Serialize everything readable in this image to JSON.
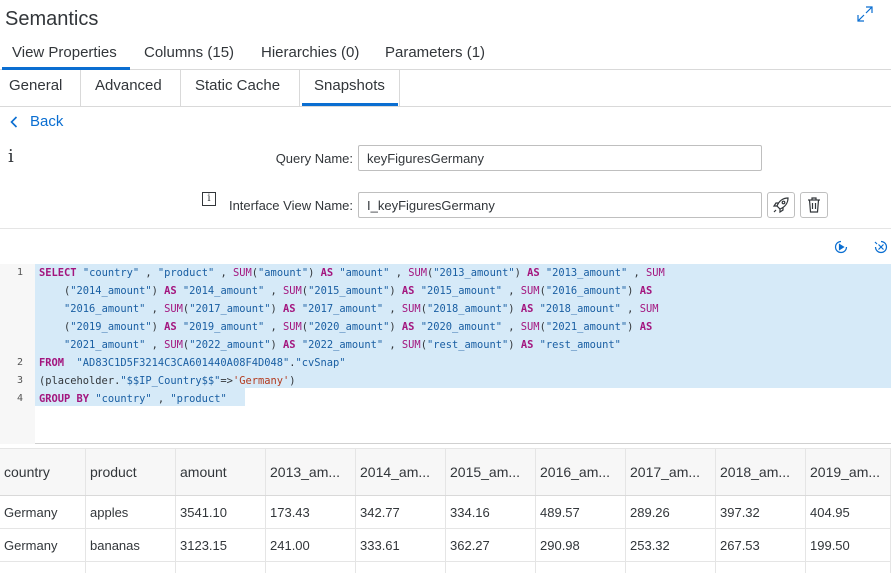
{
  "window": {
    "title": "Semantics",
    "expand_icon": "expand-icon"
  },
  "tabs_primary": [
    {
      "label": "View Properties",
      "active": true
    },
    {
      "label": "Columns (15)",
      "active": false
    },
    {
      "label": "Hierarchies (0)",
      "active": false
    },
    {
      "label": "Parameters (1)",
      "active": false
    }
  ],
  "tabs_secondary": [
    {
      "label": "General",
      "active": false
    },
    {
      "label": "Advanced",
      "active": false
    },
    {
      "label": "Static Cache",
      "active": false
    },
    {
      "label": "Snapshots",
      "active": true
    }
  ],
  "back_label": "Back",
  "info_glyph": "i",
  "form": {
    "query_name_label": "Query Name:",
    "query_name_value": "keyFiguresGermany",
    "interface_view_label": "Interface View Name:",
    "interface_view_value": "I_keyFiguresGermany",
    "info_icon_glyph": "i",
    "deploy_icon": "rocket-icon",
    "delete_icon": "trash-icon"
  },
  "editor_toolbar": {
    "run_icon": "play-icon",
    "clear_icon": "clear-icon"
  },
  "editor": {
    "line_numbers": [
      "1",
      "2",
      "3",
      "4"
    ],
    "lines": [
      "SELECT \"country\" , \"product\" , SUM(\"amount\") AS \"amount\" , SUM(\"2013_amount\") AS \"2013_amount\" , SUM",
      "    (\"2014_amount\") AS \"2014_amount\" , SUM(\"2015_amount\") AS \"2015_amount\" , SUM(\"2016_amount\") AS",
      "    \"2016_amount\" , SUM(\"2017_amount\") AS \"2017_amount\" , SUM(\"2018_amount\") AS \"2018_amount\" , SUM",
      "    (\"2019_amount\") AS \"2019_amount\" , SUM(\"2020_amount\") AS \"2020_amount\" , SUM(\"2021_amount\") AS",
      "    \"2021_amount\" , SUM(\"2022_amount\") AS \"2022_amount\" , SUM(\"rest_amount\") AS \"rest_amount\"",
      "FROM  \"AD83C1D5F3214C3CA601440A08F4D048\".\"cvSnap\"",
      "(placeholder.\"$$IP_Country$$\"=>'Germany')",
      "GROUP BY \"country\" , \"product\""
    ]
  },
  "results": {
    "columns": [
      "country",
      "product",
      "amount",
      "2013_am...",
      "2014_am...",
      "2015_am...",
      "2016_am...",
      "2017_am...",
      "2018_am...",
      "2019_am..."
    ],
    "rows": [
      [
        "Germany",
        "apples",
        "3541.10",
        "173.43",
        "342.77",
        "334.16",
        "489.57",
        "289.26",
        "397.32",
        "404.95"
      ],
      [
        "Germany",
        "bananas",
        "3123.15",
        "241.00",
        "333.61",
        "362.27",
        "290.98",
        "253.32",
        "267.53",
        "199.50"
      ]
    ]
  },
  "colors": {
    "accent": "#0a6ed1",
    "selection": "#d6eaf8",
    "keyword": "#a3157e"
  }
}
